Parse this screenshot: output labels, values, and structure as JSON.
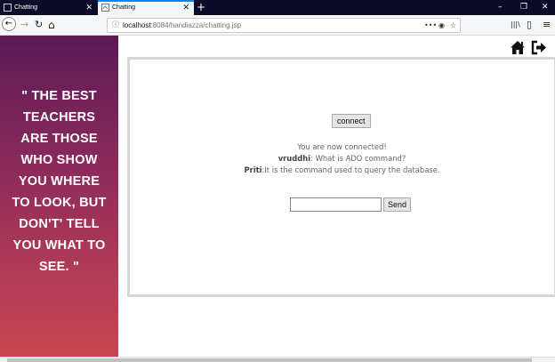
{
  "tabs": [
    {
      "title": "Chatting",
      "active": false
    },
    {
      "title": "Chatting",
      "active": true
    }
  ],
  "window_controls": {
    "minimize": "–",
    "restore": "❐",
    "close": "✕"
  },
  "toolbar": {
    "back": "←",
    "forward": "→",
    "reload": "↻",
    "home": "⌂",
    "url_host": "localhost",
    "url_rest": ":8084/handiazza/chatting.jsp",
    "menu_dots": "•••",
    "library": "|||\\",
    "sidebar": "▯",
    "app_menu": "≡"
  },
  "sidebar": {
    "quote_lines": [
      "\" THE BEST",
      "TEACHERS",
      "ARE THOSE",
      "WHO SHOW",
      "YOU WHERE",
      "TO LOOK, BUT",
      "DON'T' TELL",
      "YOU WHAT TO",
      "SEE. \""
    ]
  },
  "header_icons": [
    {
      "name": "home-icon"
    },
    {
      "name": "logout-icon"
    }
  ],
  "chat": {
    "connect_label": "connect",
    "status": "You are now connected!",
    "messages": [
      {
        "user": "vruddhi",
        "sep": ": ",
        "text": "What is ADO command?"
      },
      {
        "user": "Priti",
        "sep": ":",
        "text": "It is the command used to query the database."
      }
    ],
    "input_value": "",
    "send_label": "Send"
  },
  "colors": {
    "gradient_top": "#5a1a56",
    "gradient_bottom": "#c7454f",
    "tab_accent": "#0a84ff"
  }
}
